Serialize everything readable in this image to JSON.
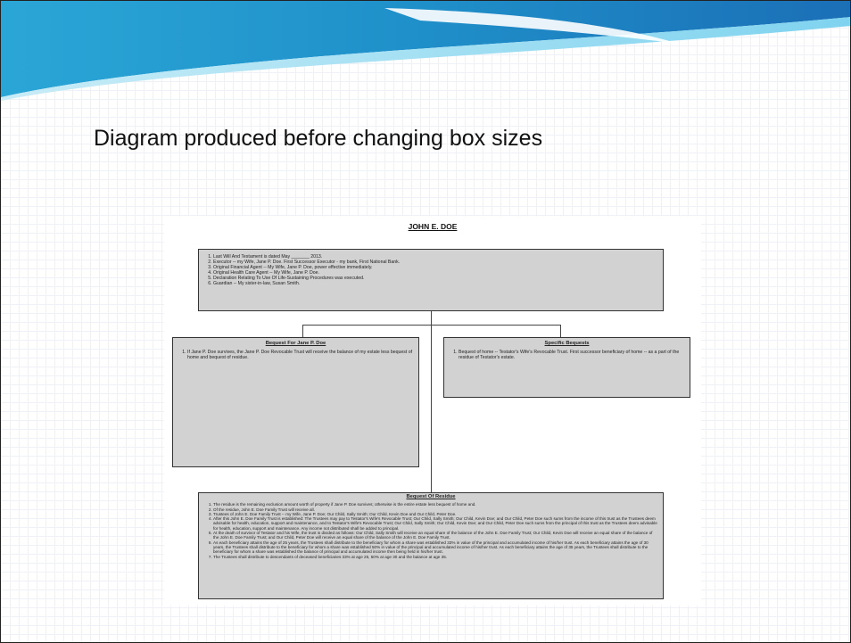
{
  "slide": {
    "title": "Diagram produced before changing box sizes"
  },
  "diagram": {
    "title": "JOHN E. DOE",
    "top_items": [
      "Last Will And Testament is dated May _______ 2013.",
      "Executor -- my Wife, Jane P. Doe.  First Successor Executor -  my bank, First National Bank.",
      "Original Financial Agent -- My Wife, Jane P. Doe, power effective immediately.",
      "Original Health Care Agent -- My Wife, Jane P. Doe.",
      "Declaration Relating To Use Of Life-Sustaining Procedures was executed.",
      "Guardian -- My sister-in-law, Susan Smith."
    ],
    "left_box": {
      "heading": "Bequest For Jane P. Doe",
      "items": [
        "If Jane P. Doe survives, the Jane P. Doe Revocable Trust will receive the balance of my estate less bequest of home and bequest of residue."
      ]
    },
    "right_box": {
      "heading": "Specific Bequests",
      "items": [
        "Bequest of home -- Testator's Wife's Revocable Trust. First successor beneficiary of home  -- as a part of the residue of Testator's estate."
      ]
    },
    "bottom_box": {
      "heading": "Bequest Of Residue",
      "items": [
        "The residue is the remaining exclusion amount worth of property if Jane P. Doe survives; otherwise is the entire estate less bequest of home and.",
        "Of the residue, John E. Doe Family Trust will receive all.",
        "Trustees of John E. Doe Family Trust -- my Wife, Jane P. Doe; Our Child, Sally Smith; Our Child, Kevin Doe and Our Child, Peter Doe.",
        "After this John E. Doe Family Trust is established:  The Trustees may pay to Testator's Wife's Revocable Trust; Our Child, Sally Smith; Our Child, Kevin Doe; and Our Child, Peter Doe such sums from the income of this trust as the Trustees deem advisable for health, education, support and maintenance, and to Testator's Wife's Revocable Trust; Our Child, Sally Smith; Our Child, Kevin Doe; and Our Child, Peter Doe such sums from the principal of this trust as the Trustees deem advisable for health, education, support and maintenance.  Any income not distributed shall be added to principal.",
        "At the death of survivor of Testator and his Wife, the trust is divided as follows: Our Child, Sally Smith will receive an equal share of the balance of the John E. Doe Family Trust; Our Child, Kevin Doe will receive an equal share of the balance of the John E. Doe Family Trust; and Our Child, Peter Doe will receive an equal share of the balance of the John E. Doe Family Trust.",
        "As each beneficiary attains the age of 25 years, the Trustees shall distribute to the beneficiary for whom a share was established 33% in value of the principal and accumulated income of his/her trust.  As each beneficiary attains the age of 30 years, the Trustees shall distribute to the beneficiary for whom a share was established 50% in value of the principal and accumulated income of his/her trust.  As each beneficiary attains the age of 35 years, the Trustees shall distribute to the beneficiary for whom a share was established the balance of principal and accumulated income then being held in his/her trust.",
        "The Trustees shall distribute to descendants of deceased beneficiaries  33% at age 25, 50% at age 30 and the balance at age 35."
      ]
    }
  }
}
